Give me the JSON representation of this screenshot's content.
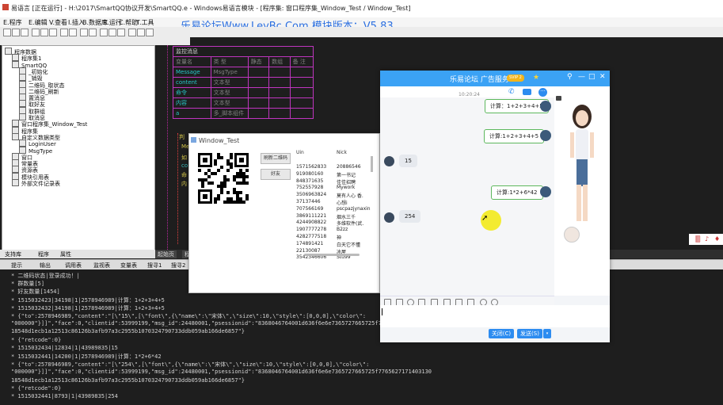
{
  "ide": {
    "title": "易语言 [正在运行] - H:\\2017\\SmartQQ协议开发\\SmartQQ.e - Windows易语言模块 - [程序集: 窗口程序集_Window_Test / Window_Test]",
    "watermark": "乐易论坛Www.LeyBc.Com 模块版本：V5.83",
    "menu": [
      "E.程序",
      "E.编辑",
      "V.查看",
      "I.插入",
      "B.数据库",
      "R.运行",
      "C.帮助",
      "T.工具",
      "W.窗口",
      "H.帮助"
    ],
    "left_tabs": [
      "支持库",
      "程序",
      "属性"
    ],
    "code_tabs": [
      "起始页",
      "程"
    ]
  },
  "tree": [
    {
      "label": "程序数据",
      "indent": 0
    },
    {
      "label": "程序集1",
      "indent": 1
    },
    {
      "label": "SmartQQ",
      "indent": 1
    },
    {
      "label": "_初始化",
      "indent": 2
    },
    {
      "label": "_销毁",
      "indent": 2
    },
    {
      "label": "二维码_取状态",
      "indent": 2
    },
    {
      "label": "二维码_刷新",
      "indent": 2
    },
    {
      "label": "置消息",
      "indent": 2
    },
    {
      "label": "取好友",
      "indent": 2
    },
    {
      "label": "取群组",
      "indent": 2
    },
    {
      "label": "取消息",
      "indent": 2
    },
    {
      "label": "窗口程序集_Window_Test",
      "indent": 1
    },
    {
      "label": "程序集",
      "indent": 1
    },
    {
      "label": "自定义数据类型",
      "indent": 1
    },
    {
      "label": "LoginUser",
      "indent": 2
    },
    {
      "label": "MsgType",
      "indent": 2
    },
    {
      "label": "窗口",
      "indent": 1
    },
    {
      "label": "常量表",
      "indent": 1
    },
    {
      "label": "资源表",
      "indent": 1
    },
    {
      "label": "模块引用表",
      "indent": 1
    },
    {
      "label": "外部文件记录表",
      "indent": 1
    }
  ],
  "code_table": {
    "heading": "监控消息",
    "header": [
      "变量名",
      "类 型",
      "静态",
      "数组",
      "备 注"
    ],
    "rows": [
      [
        "Message",
        "MsgType"
      ],
      [
        "content",
        "文本型"
      ],
      [
        "命令",
        "文本型"
      ],
      [
        "内容",
        "文本型"
      ],
      [
        "a",
        "多_脚本组件"
      ]
    ]
  },
  "side_words": [
    "判",
    "Me",
    "如",
    "co",
    "命",
    "内"
  ],
  "output_tabs": [
    "提示",
    "输出",
    "调用表",
    "监视表",
    "变量表",
    "搜寻1",
    "搜寻2",
    "剪辑历史"
  ],
  "output_lines": [
    "* 二维码状态|登录成功！|",
    "* 群数量[5]",
    "* 好友数量[1454]",
    "* 1515032423|34198|1|2578946989|计算：1+2+3+4+5",
    "* 1515032432|34198|1|2578946989|计算：1+2+3+4+5",
    "* {\"to\":2578946989,\"content\":\"[\\\"15\\\",[\\\"font\\\",{\\\"name\\\":\\\"宋体\\\",\\\"size\\\":10,\\\"style\\\":[0,0,0],\\\"color\\\":",
    "\"000000\"}]]\",\"face\":0,\"clientid\":53999199,\"msg_id\":24480001,\"psessionid\":\"8368046764001d636f6e6e7365727665725f7765627",
    "18548d1ecb1a12513c86126b3afb97a3c2955b1070324790733ddb059ab166de6857\"}",
    "* {\"retcode\":0}",
    "* 1515032434|12834|1|43989835|15",
    "* 1515032441|14200|1|2578946989|计算：1*2+6*42",
    "* {\"to\":2578946989,\"content\":\"[\\\"254\\\",[\\\"font\\\",{\\\"name\\\":\\\"宋体\\\",\\\"size\\\":10,\\\"style\\\":[0,0,0],\\\"color\\\":",
    "\"000000\"}]]\",\"face\":0,\"clientid\":53999199,\"msg_id\":24480001,\"psessionid\":\"8368046764001d636f6e6e7365727665725f7765627171403130",
    "18548d1ecb1a12513c86126b3afb97a3c2955b1070324790733ddb059ab166de6857\"}",
    "* {\"retcode\":0}",
    "* 1515032441|8793|1|43989835|254"
  ],
  "window_test": {
    "title": "Window_Test",
    "btn_refresh_qr": "刷新二维码",
    "btn_friends": "好友",
    "col_uin": "Uin",
    "col_nick": "Nick",
    "rows": [
      [
        "1571562833",
        "20886546"
      ],
      [
        "919080160",
        "第一书记"
      ],
      [
        "848371635",
        "佳佳招聘"
      ],
      [
        "752557928",
        "Mywork"
      ],
      [
        "3506963824",
        "莫有人心 香."
      ],
      [
        "37137446",
        "心想i"
      ],
      [
        "707566169",
        "pscpazjynaxin"
      ],
      [
        "3869111221",
        "烟水三千"
      ],
      [
        "4244908822",
        "多维软件(武."
      ],
      [
        "1907777278",
        "B2zz"
      ],
      [
        "4282777518",
        "神"
      ],
      [
        "174891421",
        "白天它不懂"
      ],
      [
        "22130087",
        "冰屋"
      ],
      [
        "3542346606",
        "Stu99"
      ]
    ]
  },
  "qq": {
    "title": "乐易论坛 广告服务",
    "badge": "SVIP 2",
    "timestamp": "10:20:24",
    "messages": [
      {
        "side": "right",
        "text": "计算：1+2+3+4+5"
      },
      {
        "side": "right",
        "text": "计算:1+2+3+4+5"
      },
      {
        "side": "left",
        "text": "15"
      },
      {
        "side": "right",
        "text": "计算:1*2+6*42"
      },
      {
        "side": "left",
        "text": "254"
      }
    ],
    "btn_close": "关闭(C)",
    "btn_send": "发送(S)",
    "win_controls": [
      "⚲",
      "—",
      "□",
      "✕"
    ]
  },
  "colors": {
    "qq_blue": "#3ba2f5",
    "bubble_border": "#5db85d",
    "code_border": "#bf35bf",
    "cursor_highlight": "#f3ea1a"
  }
}
